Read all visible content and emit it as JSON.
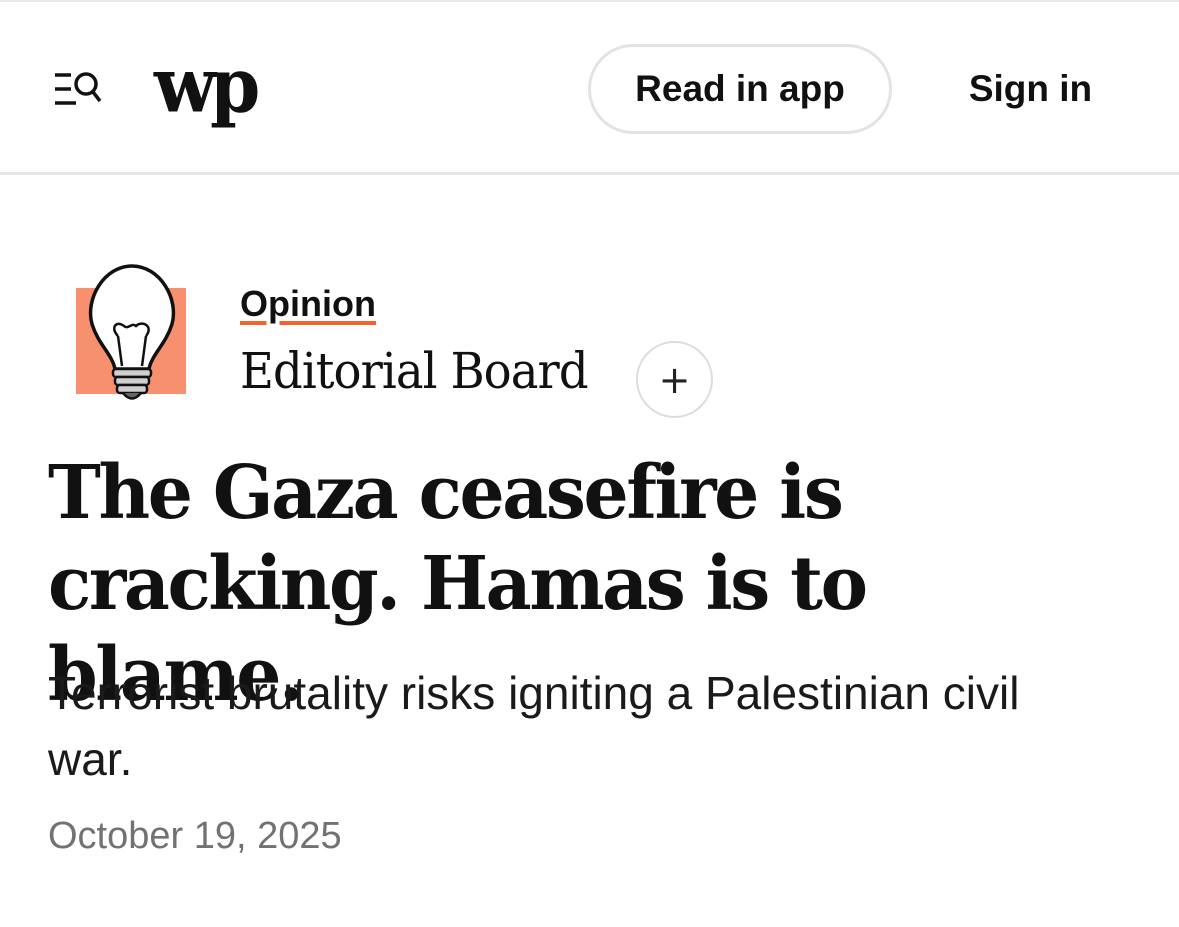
{
  "header": {
    "menu_icon": "menu-search-icon",
    "logo_text": "wp",
    "read_in_app_label": "Read in app",
    "sign_in_label": "Sign in"
  },
  "article": {
    "kicker": "Opinion",
    "author_icon": "lightbulb-icon",
    "author": "Editorial Board",
    "follow_icon": "plus-icon",
    "follow_symbol": "+",
    "headline": "The Gaza ceasefire is cracking. Hamas is to blame.",
    "dek": "Terrorist brutality risks igniting a Palestinian civil war.",
    "date": "October 19, 2025"
  },
  "colors": {
    "accent_underline": "#f2632d",
    "icon_background": "#f6906f",
    "date_gray": "#727272"
  }
}
